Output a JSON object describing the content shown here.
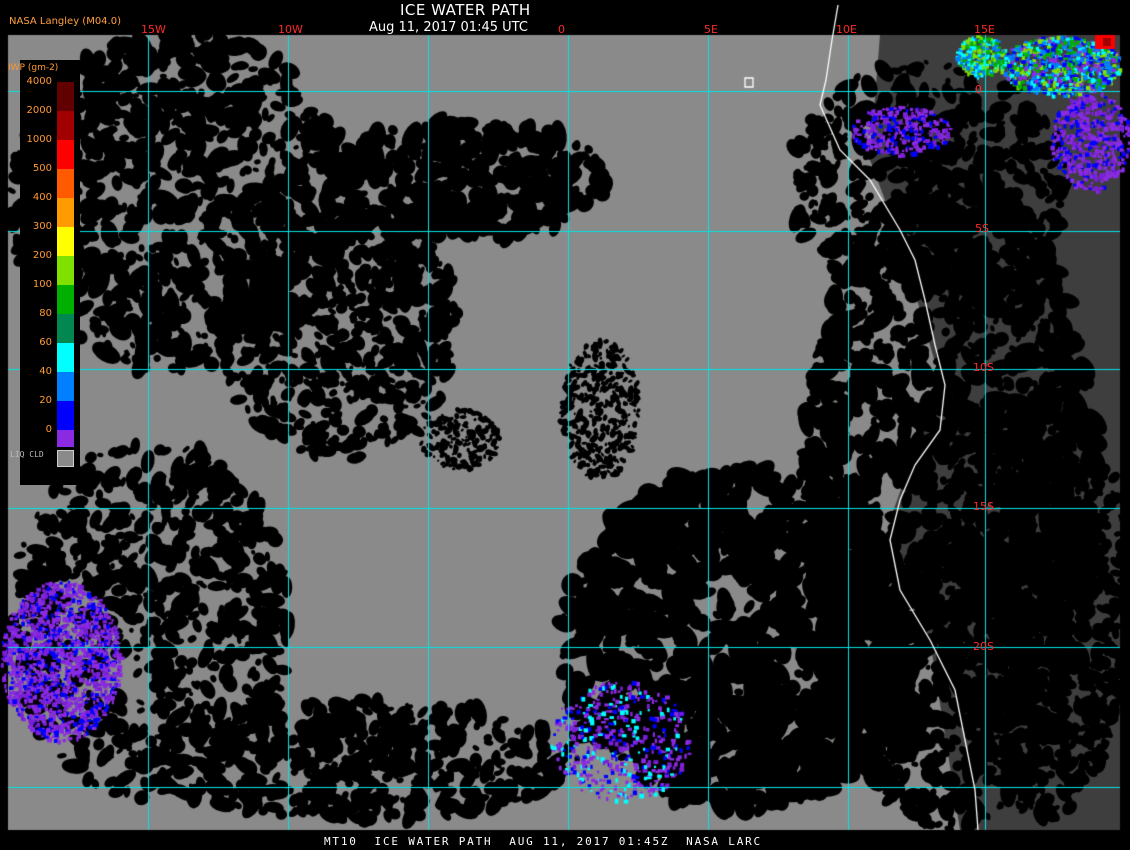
{
  "header": {
    "title": "ICE WATER PATH",
    "subtitle": "Aug 11, 2017 01:45 UTC",
    "producer": "NASA Langley (M04.0)"
  },
  "footer": {
    "caption": "MT10  ICE WATER PATH  AUG 11, 2017 01:45Z  NASA LARC"
  },
  "grid": {
    "longitude_labels": [
      "15W",
      "10W",
      "0",
      "5E",
      "10E",
      "15E"
    ],
    "latitude_labels": [
      "0",
      "5S",
      "10S",
      "15S",
      "20S"
    ]
  },
  "legend": {
    "title": "IWP (gm-2)",
    "ticks": [
      "4000",
      "2000",
      "1000",
      "500",
      "400",
      "300",
      "200",
      "100",
      "80",
      "60",
      "40",
      "20",
      "0"
    ],
    "colors": [
      "#600000",
      "#a00000",
      "#ff0000",
      "#ff5a00",
      "#ff9a00",
      "#ffff00",
      "#80e000",
      "#00b000",
      "#008850",
      "#00ffff",
      "#0080ff",
      "#0000ff",
      "#8a2be2"
    ],
    "liquid_cloud_label": "LIQ CLD",
    "liquid_cloud_color": "#8a8a8a"
  },
  "colors": {
    "background": "#000000",
    "liquid_cloud": "#8a8a8a",
    "grid_line": "#00e5e5",
    "coastline": "#ffffff",
    "label_red": "#ff2a2a",
    "label_orange": "#ffa040"
  }
}
